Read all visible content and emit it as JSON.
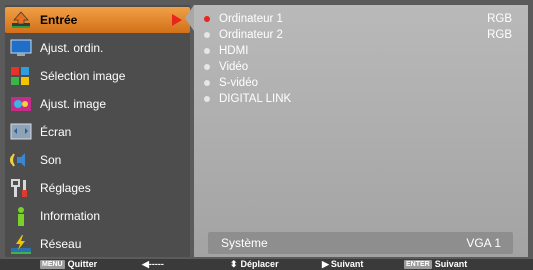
{
  "menu": {
    "items": [
      {
        "label": "Entrée",
        "icon": "input-icon",
        "selected": true
      },
      {
        "label": "Ajust. ordin.",
        "icon": "computer-adjust-icon"
      },
      {
        "label": "Sélection image",
        "icon": "image-select-icon"
      },
      {
        "label": "Ajust. image",
        "icon": "image-adjust-icon"
      },
      {
        "label": "Écran",
        "icon": "screen-icon"
      },
      {
        "label": "Son",
        "icon": "sound-icon"
      },
      {
        "label": "Réglages",
        "icon": "settings-icon"
      },
      {
        "label": "Information",
        "icon": "info-icon"
      },
      {
        "label": "Réseau",
        "icon": "network-icon"
      }
    ]
  },
  "inputs": {
    "options": [
      {
        "label": "Ordinateur 1",
        "value": "RGB",
        "active": true
      },
      {
        "label": "Ordinateur 2",
        "value": "RGB"
      },
      {
        "label": "HDMI",
        "value": ""
      },
      {
        "label": "Vidéo",
        "value": ""
      },
      {
        "label": "S-vidéo",
        "value": ""
      },
      {
        "label": "DIGITAL LINK",
        "value": ""
      }
    ],
    "system_label": "Système",
    "system_value": "VGA 1"
  },
  "footer": {
    "menu_key": "MENU",
    "quit": "Quitter",
    "left_arrow": "◀-----",
    "move": "Déplacer",
    "next": "Suivant",
    "enter_key": "ENTER",
    "enter_next": "Suivant"
  },
  "colors": {
    "accent": "#e8251c",
    "selected_bg": "#e08a30"
  }
}
